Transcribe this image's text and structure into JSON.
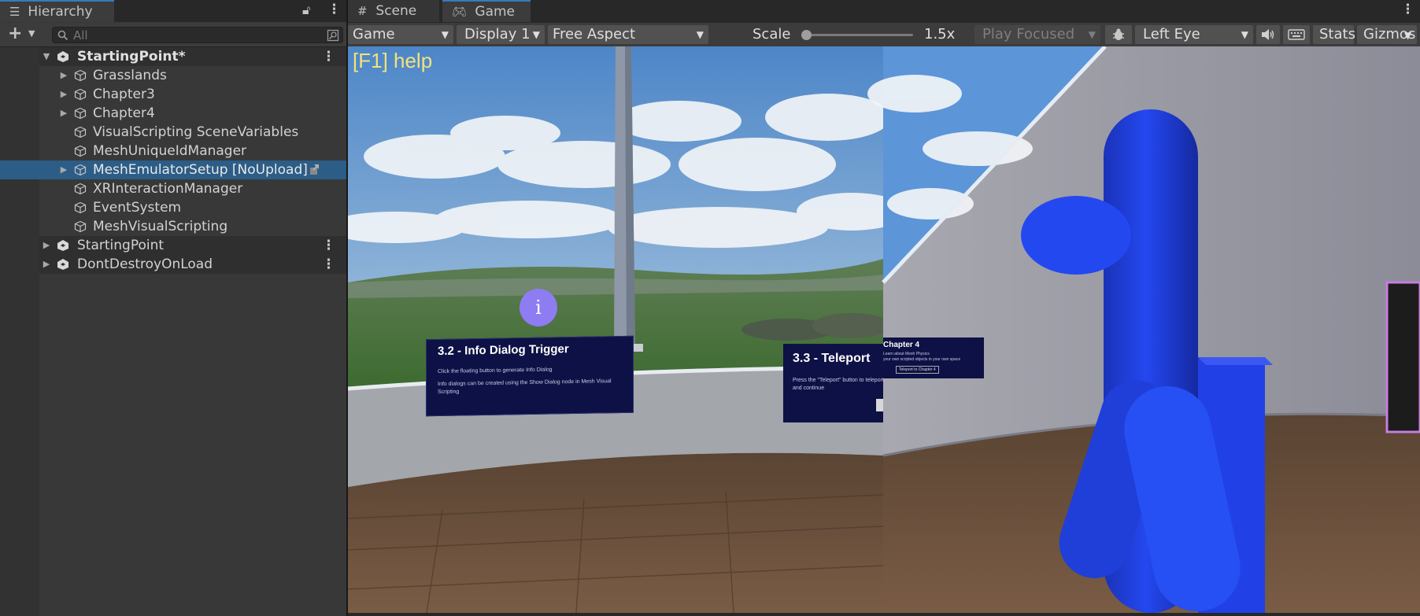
{
  "hierarchy": {
    "tab_title": "Hierarchy",
    "search_placeholder": "All",
    "items": [
      {
        "label": "StartingPoint*"
      },
      {
        "label": "Grasslands"
      },
      {
        "label": "Chapter3"
      },
      {
        "label": "Chapter4"
      },
      {
        "label": "VisualScripting SceneVariables"
      },
      {
        "label": "MeshUniqueIdManager"
      },
      {
        "label": "MeshEmulatorSetup [NoUpload]"
      },
      {
        "label": "XRInteractionManager"
      },
      {
        "label": "EventSystem"
      },
      {
        "label": "MeshVisualScripting"
      },
      {
        "label": "StartingPoint"
      },
      {
        "label": "DontDestroyOnLoad"
      }
    ]
  },
  "tabs": {
    "scene": "Scene",
    "game": "Game"
  },
  "game_toolbar": {
    "mode": "Game",
    "display": "Display 1",
    "aspect": "Free Aspect",
    "scale_label": "Scale",
    "scale_value": "1.5x",
    "play_focused": "Play Focused",
    "eye": "Left Eye",
    "stats": "Stats",
    "gizmos": "Gizmos"
  },
  "viewport": {
    "help": "[F1] help",
    "info_icon": "i",
    "card1": {
      "title": "3.2 - Info Dialog Trigger",
      "bullet1": "Click the floating button to generate Info Dialog",
      "bullet2": "Info dialogs can be created using the Show Dialog node in Mesh Visual Scripting"
    },
    "card2": {
      "title": "3.3 - Teleport",
      "bullet1": "Press the \"Teleport\" button to teleport to the top of a windmill and continue"
    },
    "card3": {
      "title": "Chapter 4",
      "line1": "Learn about Mesh Physics",
      "line2": "your own scripted objects in your own space",
      "button": "Teleport to Chapter 4"
    }
  },
  "colors": {
    "accent": "#3a79bb",
    "selection": "#2c5d87",
    "help_text": "#f2e27a",
    "character_blue": "#1f3fe0",
    "card_bg": "#0e1145"
  }
}
